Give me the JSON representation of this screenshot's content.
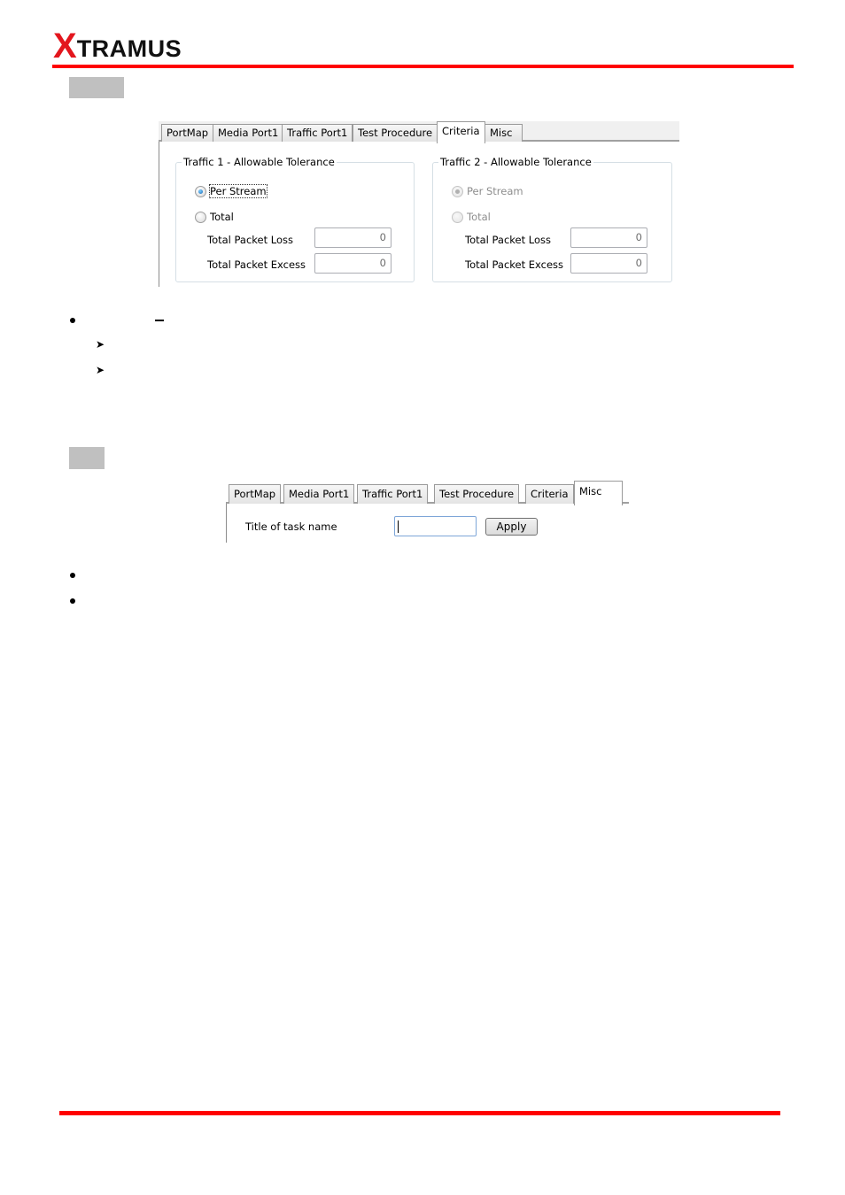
{
  "header": {
    "logo_first_letter": "X",
    "logo_rest": "TRAMUS",
    "accent_color": "#ff0000"
  },
  "criteria_panel": {
    "tabs": [
      {
        "label": "PortMap",
        "active": false
      },
      {
        "label": "Media Port1",
        "active": false
      },
      {
        "label": "Traffic Port1",
        "active": false
      },
      {
        "label": "Test Procedure",
        "active": false
      },
      {
        "label": "Criteria",
        "active": true
      },
      {
        "label": "Misc",
        "active": false
      }
    ],
    "traffic1": {
      "title": "Traffic 1 - Allowable Tolerance",
      "per_stream_label": "Per Stream",
      "per_stream_selected": true,
      "total_label": "Total",
      "total_selected": false,
      "enabled": true,
      "packet_loss_label": "Total Packet Loss",
      "packet_loss_value": "0",
      "packet_excess_label": "Total Packet Excess",
      "packet_excess_value": "0"
    },
    "traffic2": {
      "title": "Traffic 2 - Allowable Tolerance",
      "per_stream_label": "Per Stream",
      "per_stream_selected": true,
      "total_label": "Total",
      "total_selected": false,
      "enabled": false,
      "packet_loss_label": "Total Packet Loss",
      "packet_loss_value": "0",
      "packet_excess_label": "Total Packet Excess",
      "packet_excess_value": "0"
    }
  },
  "misc_panel": {
    "tabs": [
      {
        "label": "PortMap",
        "active": false
      },
      {
        "label": "Media Port1",
        "active": false
      },
      {
        "label": "Traffic Port1",
        "active": false
      },
      {
        "label": "Test Procedure",
        "active": false
      },
      {
        "label": "Criteria",
        "active": false
      },
      {
        "label": "Misc",
        "active": true
      }
    ],
    "task_name_label": "Title of task name",
    "task_name_value": "",
    "apply_label": "Apply"
  }
}
